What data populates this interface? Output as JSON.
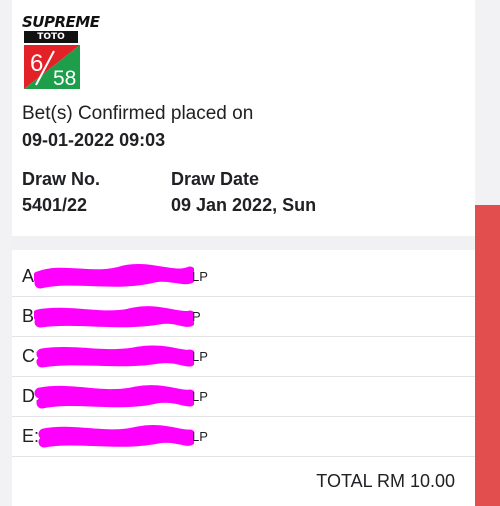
{
  "logo": {
    "word": "SUPREME",
    "bar": "TOTO",
    "num_a": "6",
    "num_b": "58",
    "colors": {
      "green": "#1e9e4b",
      "red": "#e32228"
    }
  },
  "confirmation": {
    "label": "Bet(s) Confirmed placed on",
    "datetime": "09-01-2022 09:03"
  },
  "draw": {
    "no_label": "Draw No.",
    "no_value": "5401/22",
    "date_label": "Draw Date",
    "date_value": "09 Jan 2022, Sun"
  },
  "bets": [
    {
      "letter": "A:",
      "suffix": "LP"
    },
    {
      "letter": "B:",
      "suffix": "P"
    },
    {
      "letter": "C:",
      "suffix": "LP"
    },
    {
      "letter": "D:",
      "suffix": "LP"
    },
    {
      "letter": "E:",
      "suffix": "LP"
    }
  ],
  "total": "TOTAL RM 10.00",
  "redaction_color": "#ff00ff"
}
